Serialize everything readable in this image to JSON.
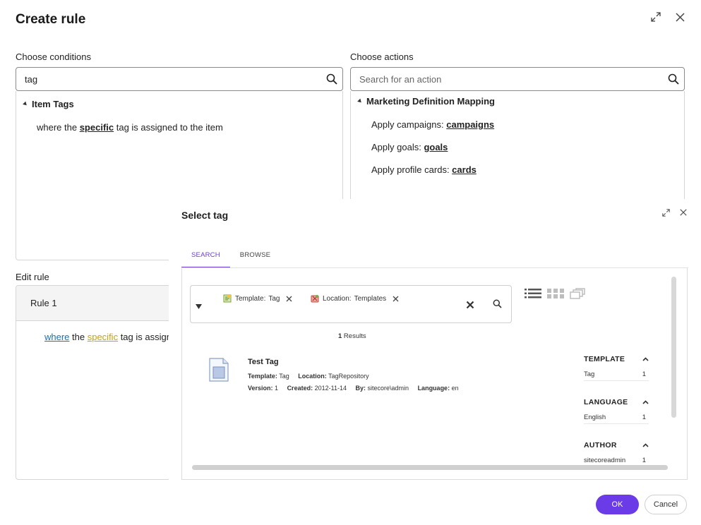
{
  "dialog": {
    "title": "Create rule"
  },
  "conditions": {
    "label": "Choose conditions",
    "search_value": "tag",
    "group": "Item Tags",
    "row": {
      "before": "where the ",
      "link": "specific",
      "after": " tag is assigned to the item"
    }
  },
  "actions": {
    "label": "Choose actions",
    "search_placeholder": "Search for an action",
    "group": "Marketing Definition Mapping",
    "items": [
      {
        "prefix": "Apply campaigns: ",
        "link": "campaigns"
      },
      {
        "prefix": "Apply goals: ",
        "link": "goals"
      },
      {
        "prefix": "Apply profile cards: ",
        "link": "cards"
      }
    ]
  },
  "edit_rule": {
    "label": "Edit rule",
    "rule_name": "Rule 1",
    "kw_where": "where",
    "text_the": " the ",
    "kw_specific": "specific",
    "text_rest": " tag is assigne"
  },
  "select_tag": {
    "title": "Select tag",
    "tabs": [
      "SEARCH",
      "BROWSE"
    ],
    "chips": [
      {
        "key": "Template:",
        "value": "Tag"
      },
      {
        "key": "Location:",
        "value": "Templates"
      }
    ],
    "results_count": "1",
    "results_label": " Results",
    "result": {
      "title": "Test Tag",
      "template_label": "Template:",
      "template_value": "Tag",
      "location_label": "Location:",
      "location_value": "TagRepository",
      "version_label": "Version:",
      "version_value": "1",
      "created_label": "Created:",
      "created_value": "2012-11-14",
      "by_label": "By:",
      "by_value": "sitecore\\admin",
      "language_label": "Language:",
      "language_value": "en"
    },
    "facets": [
      {
        "title": "TEMPLATE",
        "name": "Tag",
        "count": "1"
      },
      {
        "title": "LANGUAGE",
        "name": "English",
        "count": "1"
      },
      {
        "title": "AUTHOR",
        "name": "sitecoreadmin",
        "count": "1"
      }
    ]
  },
  "footer": {
    "ok": "OK",
    "cancel": "Cancel"
  },
  "colors": {
    "accent": "#6c3be8",
    "link_blue": "#1a6fb0",
    "link_yellow": "#c9a010"
  }
}
